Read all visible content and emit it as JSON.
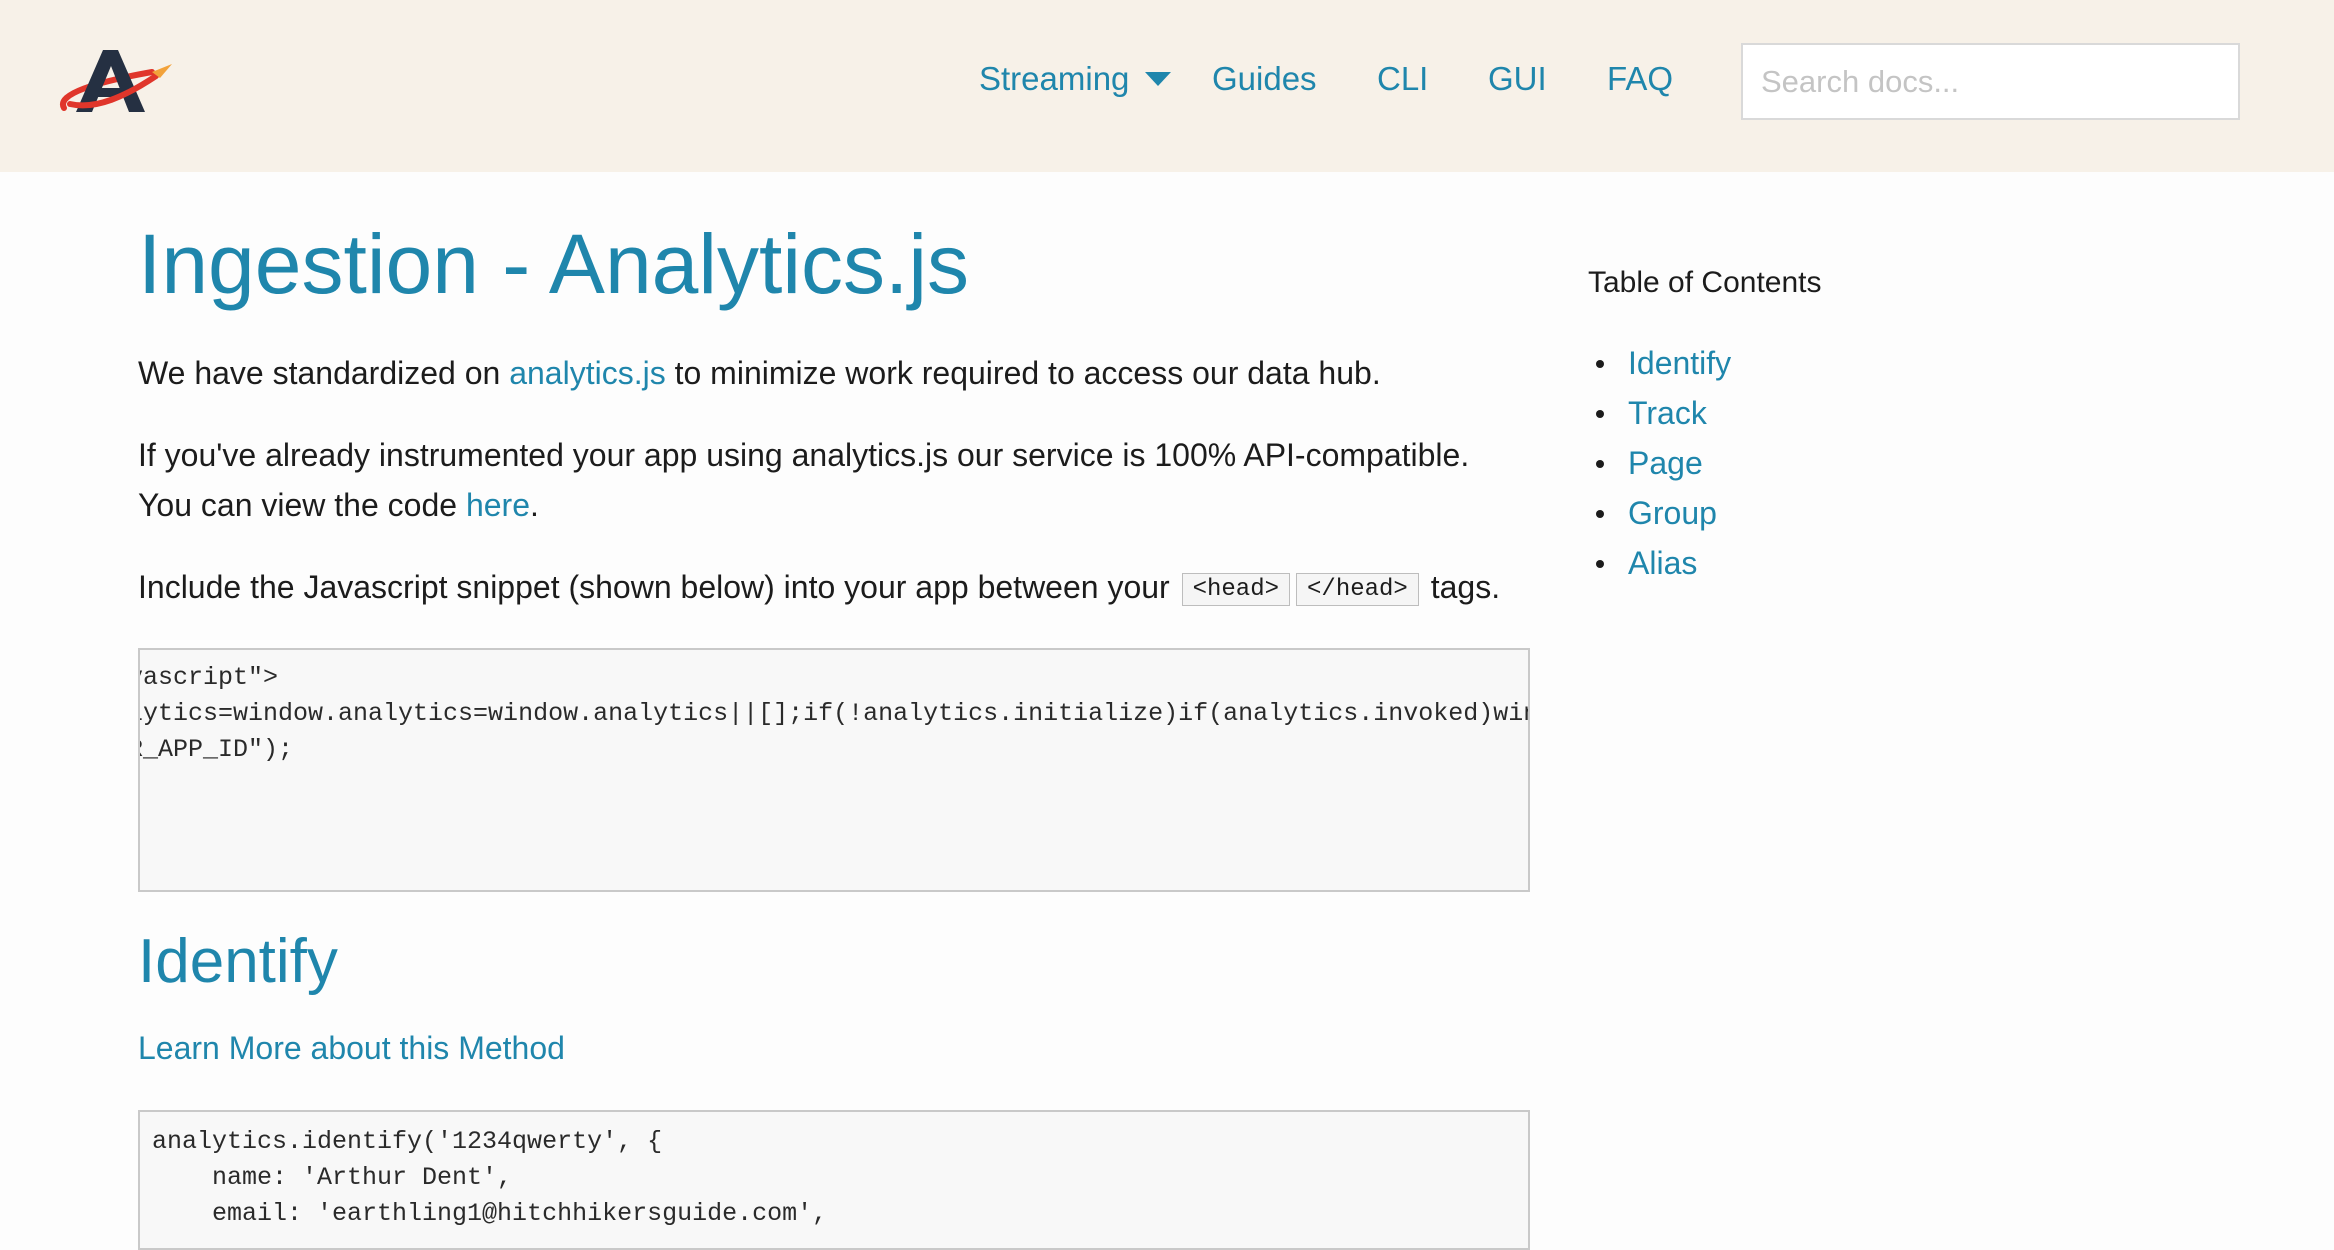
{
  "header": {
    "logo_alt": "A",
    "nav": [
      {
        "label": "Streaming",
        "has_dropdown": true
      },
      {
        "label": "Guides"
      },
      {
        "label": "CLI"
      },
      {
        "label": "GUI"
      },
      {
        "label": "FAQ"
      }
    ],
    "search_placeholder": "Search docs..."
  },
  "main": {
    "title": "Ingestion - Analytics.js",
    "intro": {
      "before": "We have standardized on ",
      "link": "analytics.js",
      "after": " to minimize work required to access our data hub."
    },
    "compat": {
      "line1": "If you've already instrumented your app using analytics.js our service is 100% API-compatible.",
      "line2_before": "You can view the code ",
      "line2_link": "here",
      "line2_after": "."
    },
    "include": {
      "before": "Include the Javascript snippet (shown below) into your app between your ",
      "code1": "<head>",
      "code2": "</head>",
      "after": " tags."
    },
    "snippet_lines": [
      "vascript\">",
      "lytics=window.analytics=window.analytics||[];if(!analytics.initialize)if(analytics.invoked)window",
      "R_APP_ID\");"
    ],
    "identify": {
      "title": "Identify",
      "learn_more": "Learn More about this Method",
      "code_lines": [
        "analytics.identify('1234qwerty', {",
        "    name: 'Arthur Dent',",
        "    email: 'earthling1@hitchhikersguide.com',"
      ]
    }
  },
  "toc": {
    "title": "Table of Contents",
    "items": [
      "Identify",
      "Track",
      "Page",
      "Group",
      "Alias"
    ]
  },
  "colors": {
    "accent": "#1f86ac",
    "header_bg": "#f7f1e8",
    "logo_dark": "#253042",
    "logo_orbit": "#e0362b",
    "logo_spark": "#f2a23a"
  }
}
